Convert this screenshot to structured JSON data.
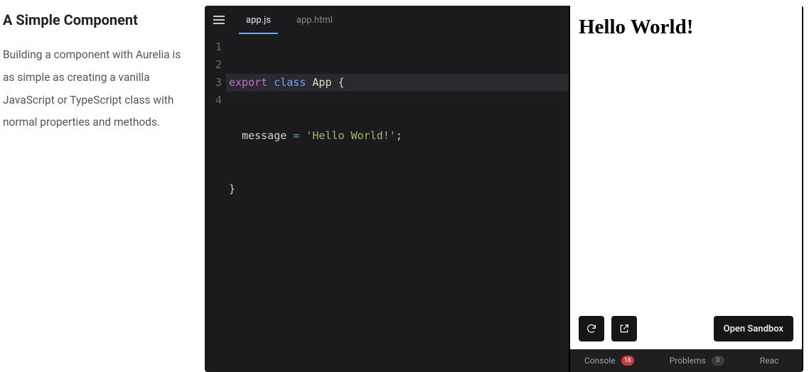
{
  "doc": {
    "title": "A Simple Component",
    "body": "Building a component with Aurelia is as simple as creating a vanilla JavaScript or TypeScript class with normal properties and methods."
  },
  "editor": {
    "tabs": [
      {
        "label": "app.js",
        "active": true
      },
      {
        "label": "app.html",
        "active": false
      }
    ],
    "line_numbers": [
      "1",
      "2",
      "3",
      "4"
    ],
    "code": {
      "l1": {
        "kw_export": "export",
        "kw_class": "class",
        "cls": "App",
        "brace": "{"
      },
      "l2": {
        "indent": "  ",
        "prop": "message",
        "eq": " = ",
        "str": "'Hello World!'",
        "semi": ";"
      },
      "l3": {
        "brace": "}"
      }
    }
  },
  "preview": {
    "output": "Hello World!",
    "open_sandbox": "Open Sandbox"
  },
  "console": {
    "console_label": "Console",
    "console_count": "18",
    "problems_label": "Problems",
    "problems_count": "0",
    "react_label": "Reac"
  }
}
